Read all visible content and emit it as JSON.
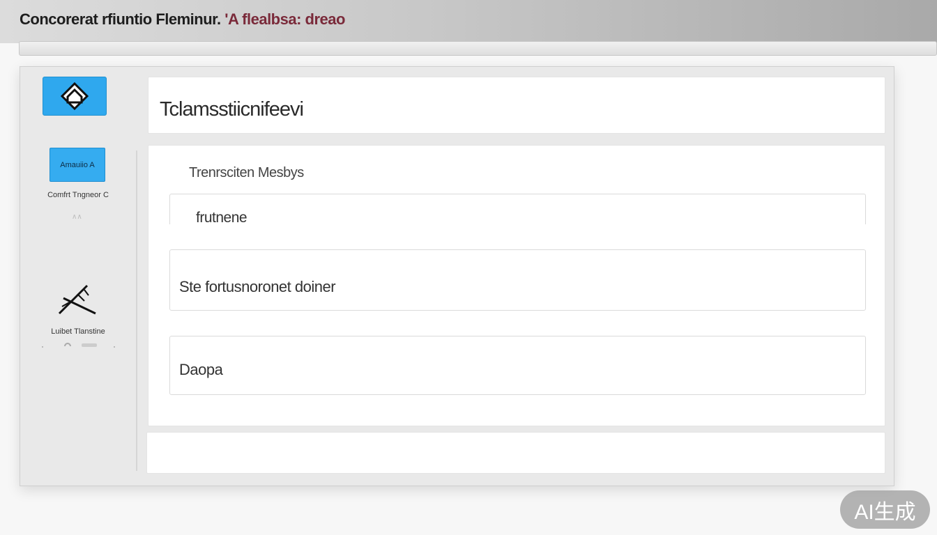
{
  "window": {
    "title_main": "Concorerat rfiuntio Fleminur. ",
    "title_accent": "'A  flealbsa:",
    "title_tail": " dreao"
  },
  "sidebar": {
    "home_icon": "home-diamond-icon",
    "account_button_label": "Amauiio A",
    "account_caption": "Comfrt Tngneor C",
    "small_glyph": "∧∧",
    "tools_icon": "crossed-tools-icon",
    "tools_caption": "Luibet Tlanstine"
  },
  "header": {
    "page_title": "Tclamsstiicnifeevi"
  },
  "form": {
    "section_label": "Trenrsciten Mesbys",
    "field_1_value": "frutnene",
    "field_2_value": "Ste fortusnoronet doiner",
    "field_3_value": "Daopa"
  },
  "badge": {
    "text": "AI生成"
  },
  "colors": {
    "accent_blue": "#2fa8ee",
    "title_accent": "#7a2a3a"
  }
}
